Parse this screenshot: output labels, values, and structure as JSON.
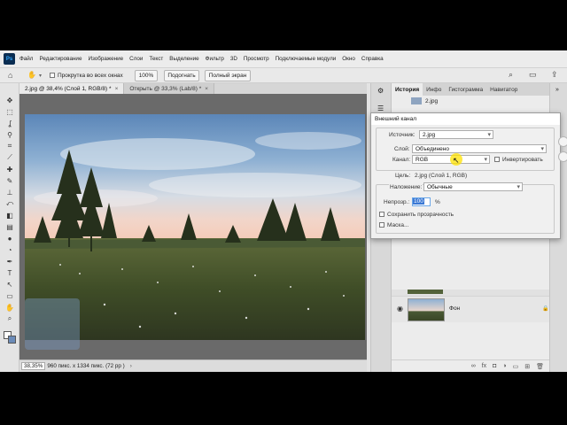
{
  "app": {
    "logo": "Ps",
    "menu": [
      "Файл",
      "Редактирование",
      "Изображение",
      "Слои",
      "Текст",
      "Выделение",
      "Фильтр",
      "3D",
      "Просмотр",
      "Подключаемые модули",
      "Окно",
      "Справка"
    ]
  },
  "options": {
    "scroll_all_label": "Прокрутка во всех окнах",
    "zoom_value": "100%",
    "fit_button": "Подогнать",
    "fullscreen_button": "Полный экран"
  },
  "tabs": [
    {
      "label": "2.jpg @ 38,4% (Слой 1, RGB/8) *",
      "close": "×"
    },
    {
      "label": "Открыть @ 33,3% (Lab/8) *",
      "close": "×"
    }
  ],
  "status": {
    "zoom": "38,35%",
    "info": "960 пикс. x 1334 пикс. (72 pp )",
    "arrow": "›"
  },
  "panel": {
    "tabs": [
      "История",
      "Инфо",
      "Гистограмма",
      "Навигатор"
    ],
    "history_item": "2.jpg",
    "layer_name": "Фон"
  },
  "dialog": {
    "title": "Внешний канал",
    "source_label": "Источник:",
    "source_value": "2.jpg",
    "layer_label": "Слой:",
    "layer_value": "Объединено",
    "channel_label": "Канал:",
    "channel_value": "RGB",
    "invert_label": "Инвертировать",
    "target_label": "Цель:",
    "target_value": "2.jpg (Слой 1, RGB)",
    "blending_label": "Наложение:",
    "blending_value": "Обычные",
    "opacity_label": "Непрозр.:",
    "opacity_value": "100",
    "opacity_unit": "%",
    "preserve_label": "Сохранить прозрачность",
    "mask_label": "Маска..."
  },
  "icons": {
    "home": "⌂",
    "hand": "✋",
    "search": "⌕",
    "layout": "▭",
    "upload": "⇪",
    "move": "✥",
    "marquee": "⬚",
    "lasso": "ʆ",
    "wand": "⚲",
    "crop": "⌗",
    "eyedropper": "⟋",
    "heal": "✚",
    "brush": "✎",
    "stamp": "⊥",
    "history-brush": "⤺",
    "eraser": "◧",
    "gradient": "▤",
    "blur": "●",
    "dodge": "◔",
    "pen": "✒",
    "type": "T",
    "path": "↖",
    "shape": "▭",
    "hand-tool": "✋",
    "zoom": "⌕",
    "eye": "◉",
    "lock": "🔒"
  },
  "colors": {
    "accent": "#31a8ff",
    "photoshop_dark": "#0a2d52",
    "highlight": "#ffe100"
  }
}
